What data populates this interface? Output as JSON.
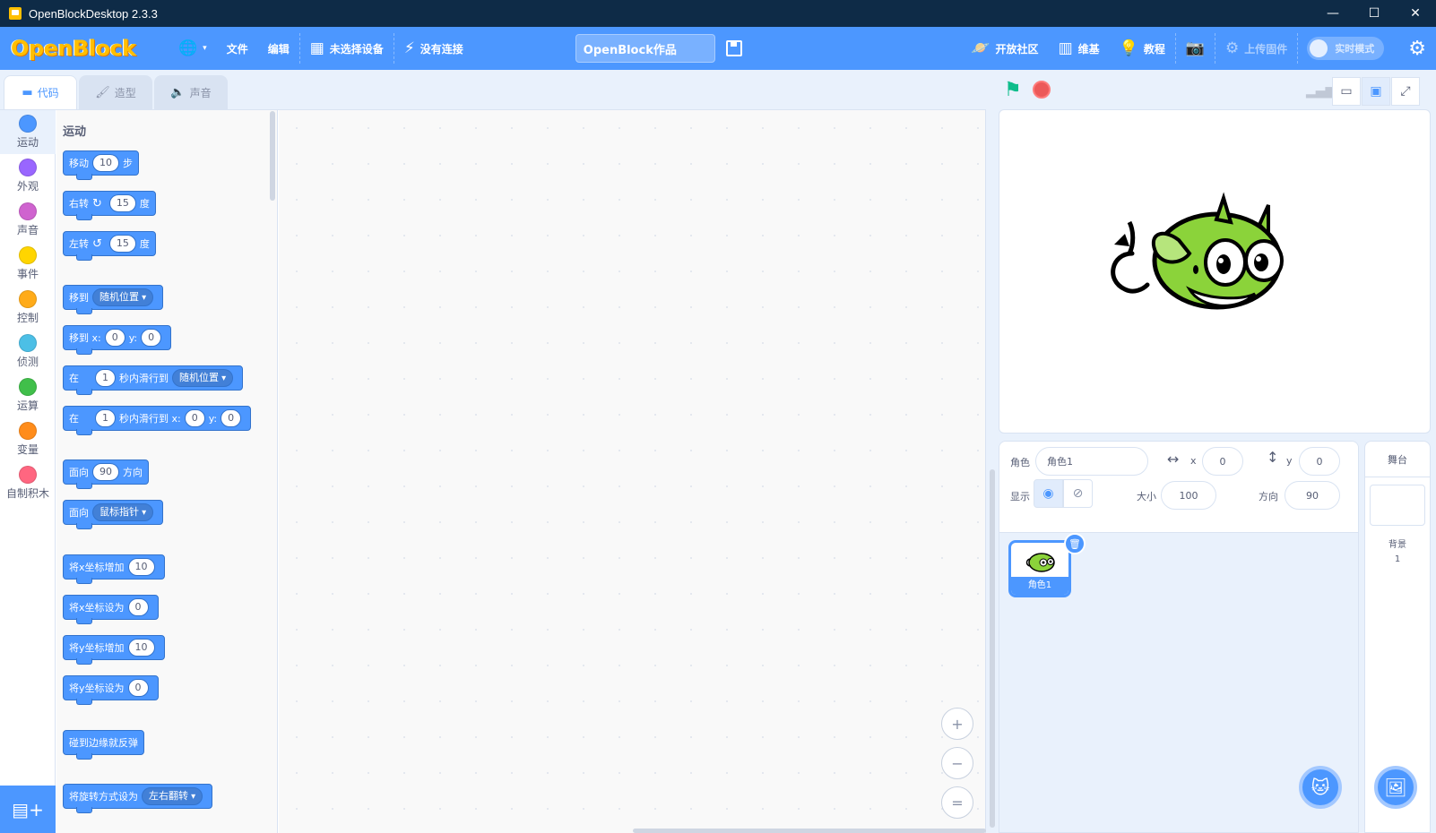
{
  "window": {
    "title": "OpenBlockDesktop 2.3.3",
    "minimize": "—",
    "maximize": "☐",
    "close": "✕"
  },
  "menubar": {
    "logo": "OpenBlock",
    "language_icon": "🌐",
    "file": "文件",
    "edit": "编辑",
    "device": "未选择设备",
    "connection": "没有连接",
    "project_title": "OpenBlock作品",
    "community": "开放社区",
    "wiki": "维基",
    "tutorial": "教程",
    "upload_firmware": "上传固件",
    "realtime_mode": "实时模式"
  },
  "tabs": [
    {
      "label": "代码",
      "icon": "code-icon"
    },
    {
      "label": "造型",
      "icon": "brush-icon"
    },
    {
      "label": "声音",
      "icon": "speaker-icon"
    }
  ],
  "categories": [
    {
      "label": "运动",
      "color": "#4c97ff"
    },
    {
      "label": "外观",
      "color": "#9966ff"
    },
    {
      "label": "声音",
      "color": "#cf63cf"
    },
    {
      "label": "事件",
      "color": "#ffd500"
    },
    {
      "label": "控制",
      "color": "#ffab19"
    },
    {
      "label": "侦测",
      "color": "#4cbfe6"
    },
    {
      "label": "运算",
      "color": "#40bf4a"
    },
    {
      "label": "变量",
      "color": "#ff8c1a"
    },
    {
      "label": "自制积木",
      "color": "#ff6680"
    }
  ],
  "palette": {
    "heading": "运动",
    "blocks": {
      "move": {
        "a": "移动",
        "v": "10",
        "b": "步"
      },
      "turn_right": {
        "a": "右转",
        "icon": "↻",
        "v": "15",
        "b": "度"
      },
      "turn_left": {
        "a": "左转",
        "icon": "↺",
        "v": "15",
        "b": "度"
      },
      "goto": {
        "a": "移到",
        "dd": "随机位置"
      },
      "goto_xy": {
        "a": "移到 x:",
        "x": "0",
        "b": "y:",
        "y": "0"
      },
      "glide_to": {
        "a": "在",
        "v": "1",
        "b": "秒内滑行到",
        "dd": "随机位置"
      },
      "glide_xy": {
        "a": "在",
        "v": "1",
        "b": "秒内滑行到 x:",
        "x": "0",
        "c": "y:",
        "y": "0"
      },
      "point_dir": {
        "a": "面向",
        "v": "90",
        "b": "方向"
      },
      "point_towards": {
        "a": "面向",
        "dd": "鼠标指针"
      },
      "change_x": {
        "a": "将x坐标增加",
        "v": "10"
      },
      "set_x": {
        "a": "将x坐标设为",
        "v": "0"
      },
      "change_y": {
        "a": "将y坐标增加",
        "v": "10"
      },
      "set_y": {
        "a": "将y坐标设为",
        "v": "0"
      },
      "bounce": {
        "a": "碰到边缘就反弹"
      },
      "rotation_style": {
        "a": "将旋转方式设为",
        "dd": "左右翻转"
      }
    }
  },
  "zoom": {
    "in": "+",
    "out": "−",
    "reset": "="
  },
  "sprite_info": {
    "sprite_label": "角色",
    "sprite_name": "角色1",
    "x_label": "x",
    "x_value": "0",
    "y_label": "y",
    "y_value": "0",
    "show_label": "显示",
    "size_label": "大小",
    "size_value": "100",
    "direction_label": "方向",
    "direction_value": "90"
  },
  "sprites": [
    {
      "name": "角色1"
    }
  ],
  "stage_panel": {
    "title": "舞台",
    "backdrops_label": "背景",
    "backdrops_count": "1"
  }
}
